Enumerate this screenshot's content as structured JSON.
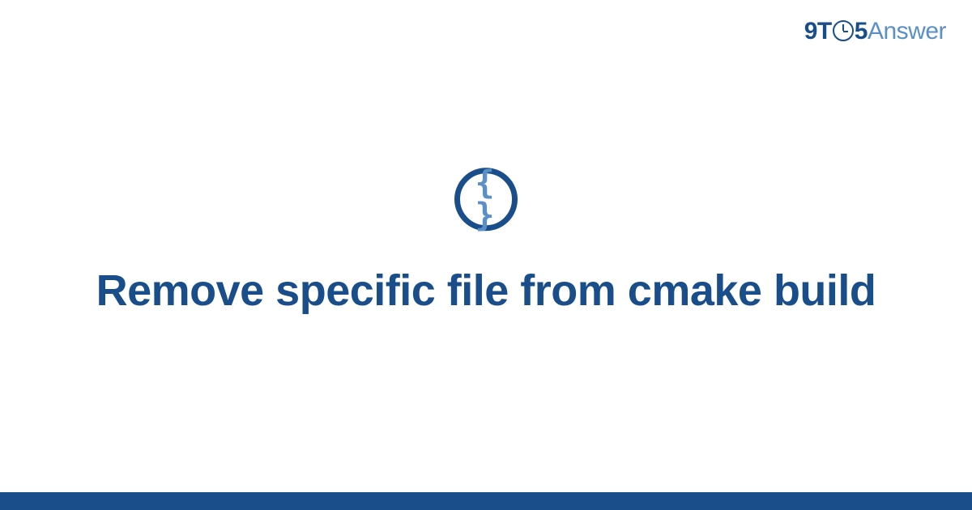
{
  "brand": {
    "part1": "9T",
    "part2": "5",
    "part3": "Answer"
  },
  "icon": {
    "name": "code-braces",
    "glyph": "{ }"
  },
  "title": "Remove specific file from cmake build",
  "colors": {
    "primary": "#1a4e8a",
    "secondary": "#5a8fc7"
  }
}
